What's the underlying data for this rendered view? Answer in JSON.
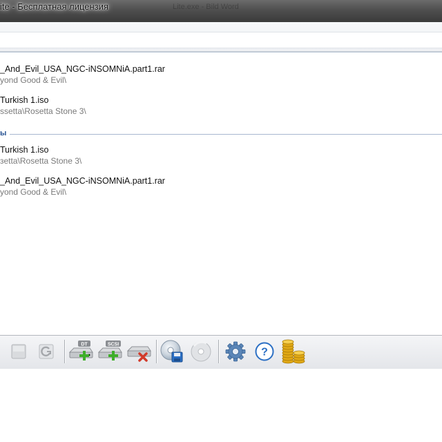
{
  "window": {
    "title": "ite - Бесплатная лицензия",
    "ghost_text": "Lite.exe - Bild Word"
  },
  "list": {
    "recent": [
      {
        "name": "_And_Evil_USA_NGC-iNSOMNiA.part1.rar",
        "path": "yond Good & Evil\\"
      },
      {
        "name": "Turkish 1.iso",
        "path": "ssetta\\Rosetta Stone 3\\"
      }
    ],
    "group_header": "ы",
    "group": [
      {
        "name": "Turkish 1.iso",
        "path": "зetta\\Rosetta Stone 3\\"
      },
      {
        "name": "_And_Evil_USA_NGC-iNSOMNiA.part1.rar",
        "path": "yond Good & Evil\\"
      }
    ]
  },
  "toolbar": {
    "buttons": [
      {
        "name": "stop-button",
        "icon": "stop-square-icon"
      },
      {
        "name": "refresh-button",
        "icon": "refresh-icon"
      },
      {
        "name": "add-dt-drive-button",
        "icon": "add-dt-drive-icon",
        "badge": "DT"
      },
      {
        "name": "add-scsi-drive-button",
        "icon": "add-scsi-drive-icon",
        "badge": "SCSI"
      },
      {
        "name": "remove-drive-button",
        "icon": "remove-drive-icon"
      },
      {
        "name": "make-image-button",
        "icon": "disc-save-icon"
      },
      {
        "name": "burn-disc-button",
        "icon": "disc-icon"
      },
      {
        "name": "settings-button",
        "icon": "gear-icon"
      },
      {
        "name": "help-button",
        "icon": "help-icon"
      },
      {
        "name": "buy-button",
        "icon": "coins-icon"
      }
    ]
  },
  "colors": {
    "group_header": "#2a5594",
    "path_text": "#7a7a7a",
    "accent_blue": "#2b6fc4",
    "add_green": "#3fae2a",
    "remove_red": "#d23a2a",
    "coins_gold": "#e0a816"
  }
}
